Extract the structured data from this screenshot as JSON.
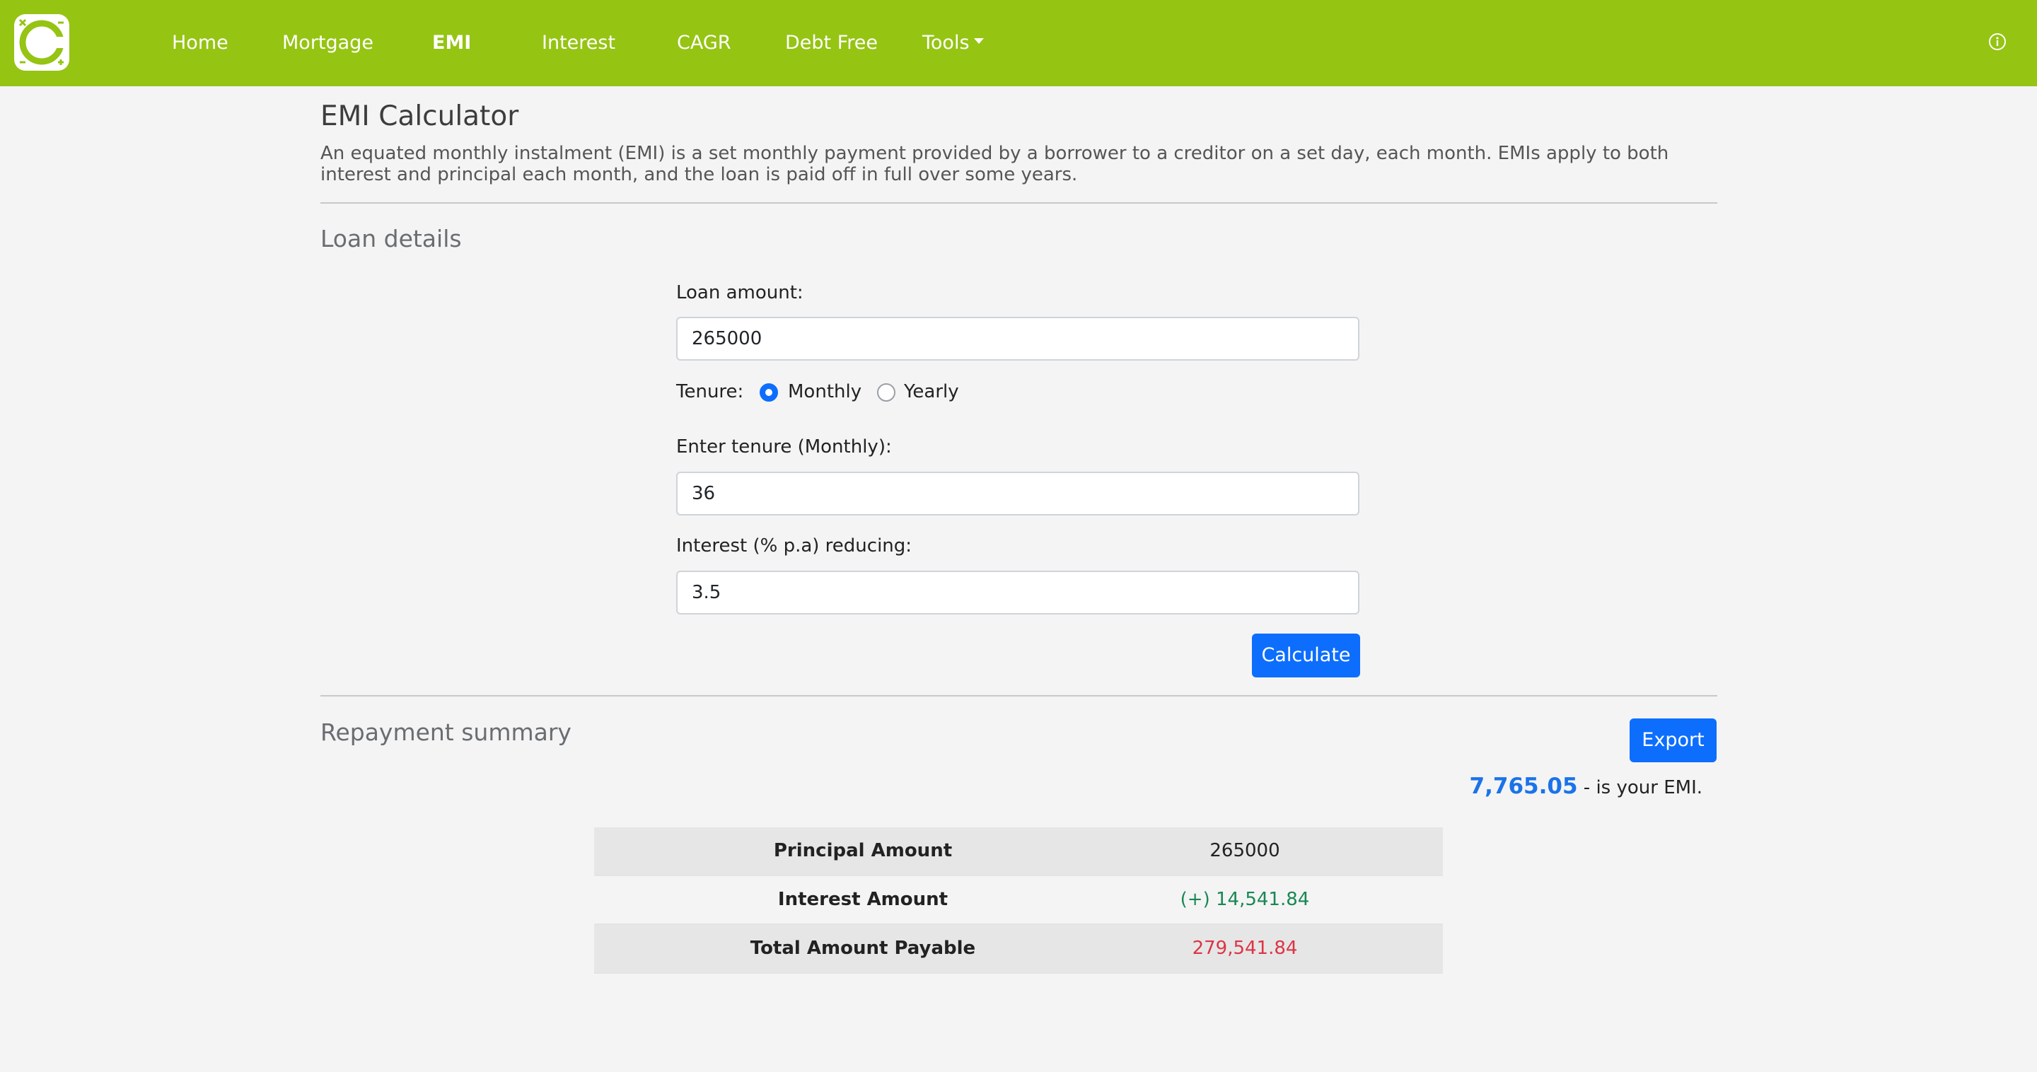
{
  "nav": {
    "items": [
      "Home",
      "Mortgage",
      "EMI",
      "Interest",
      "CAGR",
      "Debt Free",
      "Tools"
    ],
    "active": "EMI",
    "logo_icon": "calculator-logo",
    "info_icon": "info-circle-icon",
    "bg_color": "#95c413"
  },
  "page": {
    "title": "EMI Calculator",
    "description": "An equated monthly instalment (EMI) is a set monthly payment provided by a borrower to a creditor on a set day, each month. EMIs apply to both interest and principal each month, and the loan is paid off in full over some years."
  },
  "loan": {
    "section_title": "Loan details",
    "amount_label": "Loan amount:",
    "amount_value": "265000",
    "tenure_label": "Tenure:",
    "tenure_options": [
      "Monthly",
      "Yearly"
    ],
    "tenure_selected": "Monthly",
    "tenure_input_label": "Enter tenure (Monthly):",
    "tenure_value": "36",
    "interest_label": "Interest (% p.a) reducing:",
    "interest_value": "3.5",
    "calculate_label": "Calculate"
  },
  "summary": {
    "section_title": "Repayment summary",
    "export_label": "Export",
    "emi_value": "7,765.05",
    "emi_suffix": " - is your EMI.",
    "rows": [
      {
        "label": "Principal Amount",
        "value": "265000",
        "color": "#222222"
      },
      {
        "label": "Interest Amount",
        "value": "(+) 14,541.84",
        "color": "#198754"
      },
      {
        "label": "Total Amount Payable",
        "value": "279,541.84",
        "color": "#dc3545"
      }
    ]
  },
  "colors": {
    "accent": "#0d6efd",
    "emi": "#1a73e8"
  }
}
